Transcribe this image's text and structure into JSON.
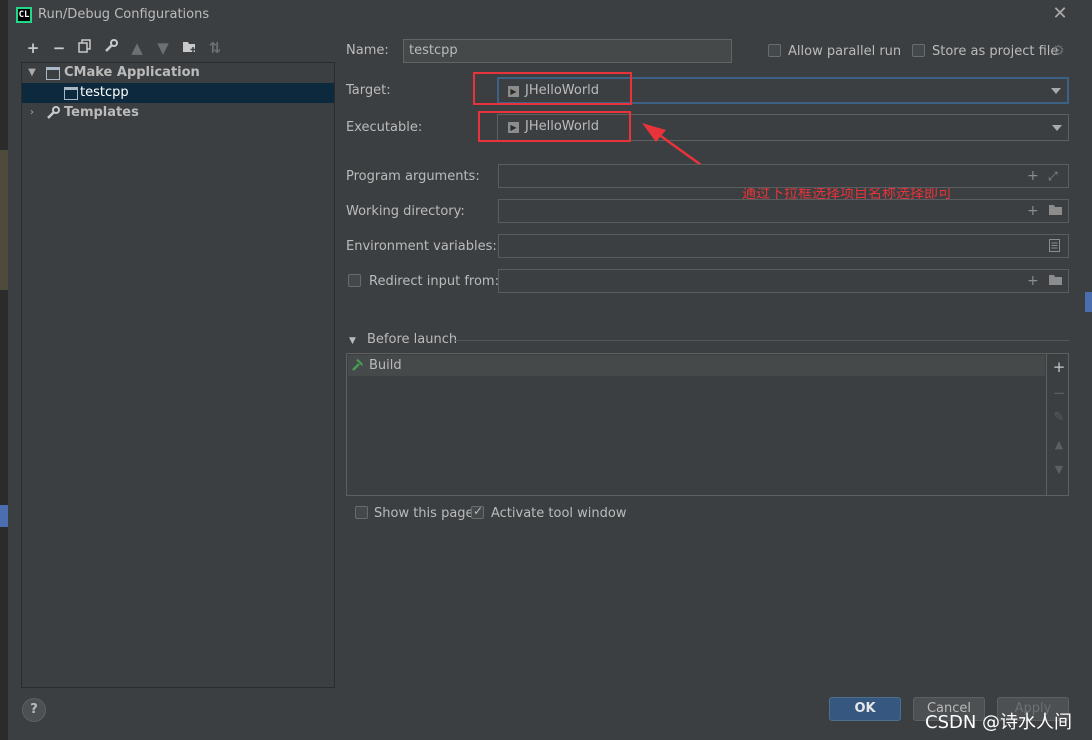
{
  "window": {
    "app_logo": "CL",
    "title": "Run/Debug Configurations"
  },
  "toolbar": [
    "add-icon",
    "remove-icon",
    "copy-icon",
    "wrench-icon",
    "move-up-icon",
    "move-down-icon",
    "new-folder-icon",
    "sort-icon"
  ],
  "tree": {
    "group": "CMake Application",
    "item": "testcpp",
    "templates": "Templates"
  },
  "form": {
    "name_label": "Name:",
    "name_value": "testcpp",
    "allow_parallel_label": "Allow parallel run",
    "store_project_label": "Store as project file",
    "target_label": "Target:",
    "target_value": "JHelloWorld",
    "executable_label": "Executable:",
    "executable_value": "JHelloWorld",
    "program_args_label": "Program arguments:",
    "working_dir_label": "Working directory:",
    "env_vars_label": "Environment variables:",
    "redirect_label": "Redirect input from:"
  },
  "annotation": {
    "text": "通过下拉框选择项目名称选择即可",
    "color": "#e8333a"
  },
  "before_launch": {
    "title": "Before launch",
    "items": [
      "Build"
    ]
  },
  "options": {
    "show_page_label": "Show this page",
    "show_page_checked": false,
    "activate_tool_label": "Activate tool window",
    "activate_tool_checked": true
  },
  "buttons": {
    "ok": "OK",
    "cancel": "Cancel",
    "apply": "Apply",
    "help": "?"
  },
  "watermark": "CSDN @诗水人间",
  "colors": {
    "accent": "#365880",
    "focus_border": "#3d6185",
    "annotation_red": "#e8333a"
  }
}
